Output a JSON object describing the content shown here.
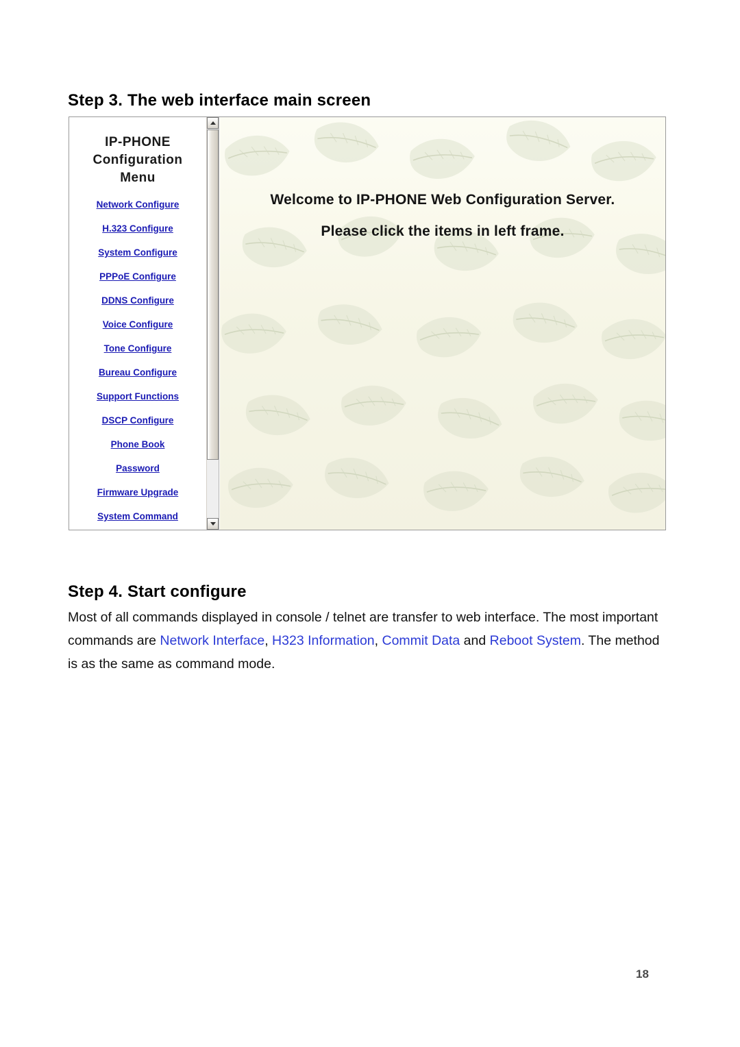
{
  "document": {
    "step3_heading": "Step 3. The web interface main screen",
    "step4_heading": "Step 4. Start configure",
    "page_number": "18"
  },
  "screenshot": {
    "left_frame": {
      "menu_title_line1": "IP-PHONE",
      "menu_title_line2": "Configuration",
      "menu_title_line3": "Menu",
      "items": [
        {
          "label": "Network Configure"
        },
        {
          "label": "H.323 Configure"
        },
        {
          "label": "System Configure"
        },
        {
          "label": "PPPoE Configure"
        },
        {
          "label": "DDNS Configure"
        },
        {
          "label": "Voice Configure"
        },
        {
          "label": "Tone Configure"
        },
        {
          "label": "Bureau Configure"
        },
        {
          "label": "Support Functions"
        },
        {
          "label": "DSCP Configure"
        },
        {
          "label": "Phone Book"
        },
        {
          "label": "Password"
        },
        {
          "label": "Firmware Upgrade"
        },
        {
          "label": "System Command"
        }
      ],
      "scrollbar": {
        "up_arrow": "scroll-up-arrow",
        "down_arrow": "scroll-down-arrow"
      }
    },
    "right_frame": {
      "welcome_line1": "Welcome to IP-PHONE Web Configuration Server.",
      "welcome_line2": "Please click the items in left frame."
    }
  },
  "paragraph": {
    "part1": "Most of all commands displayed in console / telnet are transfer to web interface. The most",
    "part2": "important commands are ",
    "link1": "Network Interface",
    "sep1": ", ",
    "link2": "H323 Information",
    "sep2": ", ",
    "link3": "Commit Data",
    "sep3": " and ",
    "link4": "Reboot System",
    "part3": ". The method is as the same as command mode."
  },
  "colors": {
    "link_blue": "#1b1bb4",
    "text_blue": "#2b3ad6",
    "frame_bg": "#fbfbf2"
  }
}
